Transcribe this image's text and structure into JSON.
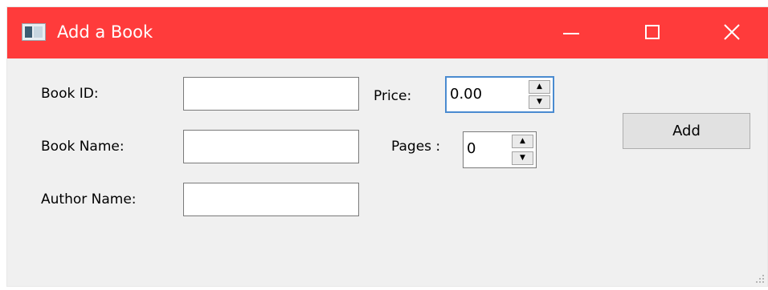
{
  "window": {
    "title": "Add a Book",
    "accent_color": "#ff3b3b",
    "icons": {
      "app": "app-window-icon",
      "minimize": "minimize-icon",
      "maximize": "maximize-icon",
      "close": "close-icon"
    }
  },
  "form": {
    "book_id_label": "Book ID:",
    "book_id_value": "",
    "book_name_label": "Book Name:",
    "book_name_value": "",
    "author_name_label": "Author Name:",
    "author_name_value": "",
    "price_label": "Price:",
    "price_value": "0.00",
    "pages_label": "Pages :",
    "pages_value": "0",
    "up_arrow": "▲",
    "down_arrow": "▼"
  },
  "actions": {
    "add_label": "Add"
  }
}
